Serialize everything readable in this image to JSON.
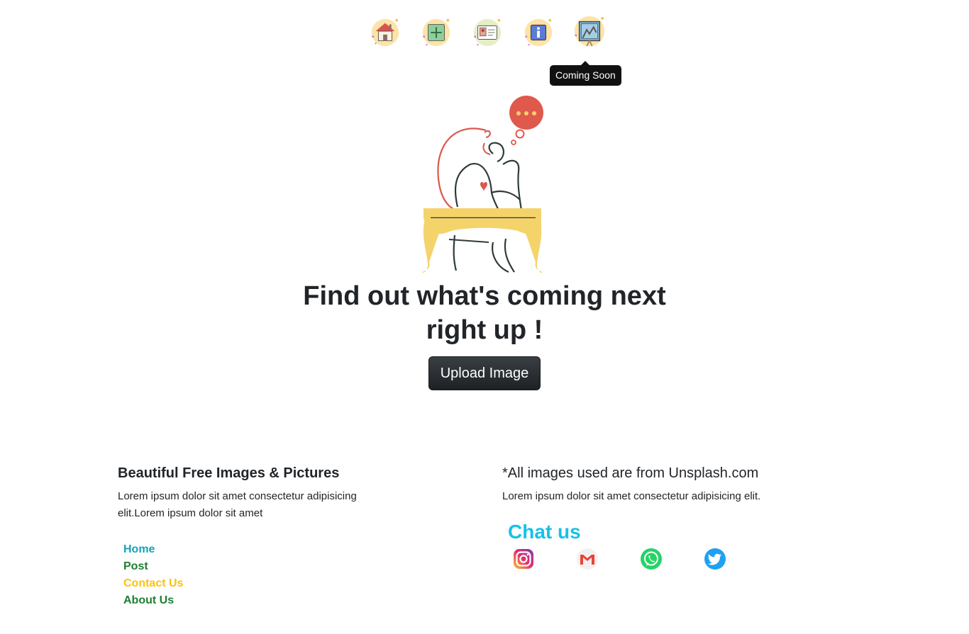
{
  "nav": {
    "items": [
      {
        "name": "home"
      },
      {
        "name": "post"
      },
      {
        "name": "contact"
      },
      {
        "name": "about"
      },
      {
        "name": "coming-soon"
      }
    ],
    "tooltip": "Coming Soon"
  },
  "hero": {
    "title": "Find out what's coming next right up !",
    "button_label": "Upload Image"
  },
  "footer": {
    "left": {
      "heading": "Beautiful Free Images & Pictures",
      "text": "Lorem ipsum dolor sit amet consectetur adipisicing elit.Lorem ipsum dolor sit amet",
      "links": [
        {
          "label": "Home",
          "color": "#17a2b8"
        },
        {
          "label": "Post",
          "color": "#1e7e34"
        },
        {
          "label": "Contact Us",
          "color": "#ffc107"
        },
        {
          "label": "About Us",
          "color": "#1e7e34"
        }
      ]
    },
    "right": {
      "heading": "*All images used are from Unsplash.com",
      "text": "Lorem ipsum dolor sit amet consectetur adipisicing elit.",
      "chat_title": "Chat us",
      "social": [
        "instagram-icon",
        "gmail-icon",
        "whatsapp-icon",
        "twitter-icon"
      ]
    }
  },
  "colors": {
    "chat_title": "#17c1e8",
    "button_bg": "#212529"
  }
}
